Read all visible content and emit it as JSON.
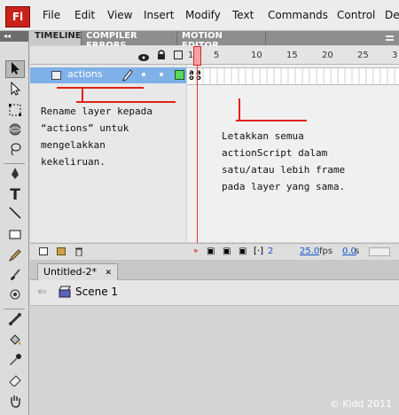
{
  "app": {
    "logo": "Fl"
  },
  "menu": [
    "File",
    "Edit",
    "View",
    "Insert",
    "Modify",
    "Text",
    "Commands",
    "Control",
    "De"
  ],
  "panel_tabs": [
    "TIMELINE",
    "COMPILER ERRORS",
    "MOTION EDITOR"
  ],
  "timeline": {
    "layer_name": "actions",
    "ruler": [
      "1",
      "5",
      "10",
      "15",
      "20",
      "25",
      "3"
    ],
    "current_frame": "2",
    "fps": "25.0",
    "fps_unit": "fps",
    "time": "0.0",
    "time_unit": "s"
  },
  "document": {
    "tab_label": "Untitled-2*",
    "tab_close": "✕",
    "scene_label": "Scene 1"
  },
  "annotations": {
    "left_note": [
      "Rename layer kepada",
      "“actions” untuk",
      "mengelakkan",
      "kekeliruan."
    ],
    "right_note": [
      "Letakkan semua",
      "actionScript dalam",
      "satu/atau lebih frame",
      "pada layer yang sama."
    ]
  },
  "copyright": "© Kidd 2011",
  "colors": {
    "layer_highlight": "#7fb0e8",
    "playhead": "#e03030",
    "logo_red": "#c8221a"
  }
}
